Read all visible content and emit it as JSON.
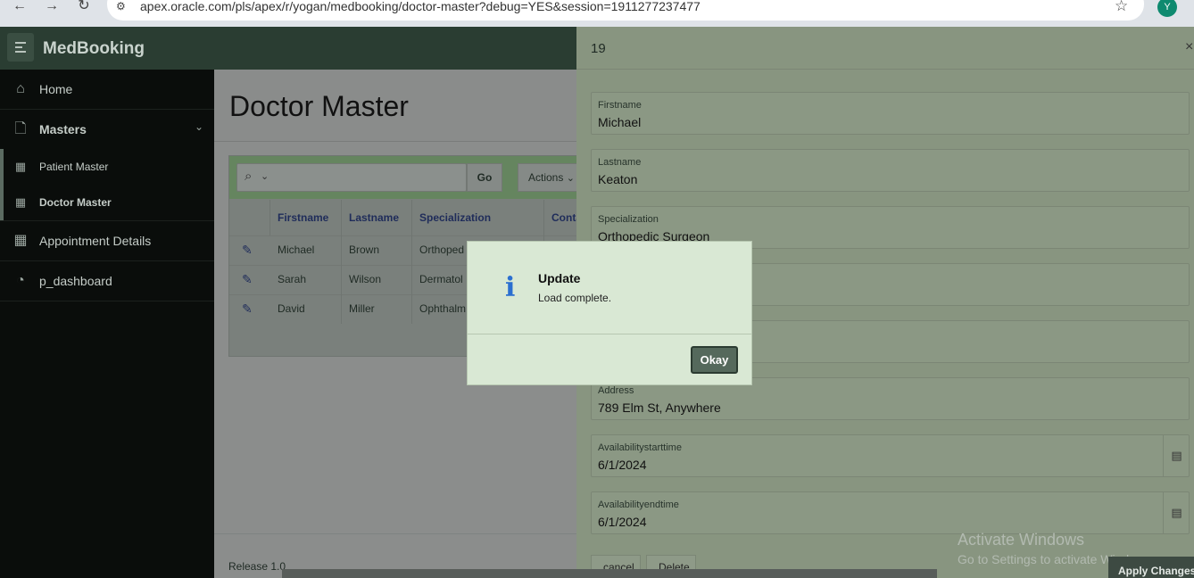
{
  "browser": {
    "url": "apex.oracle.com/pls/apex/r/yogan/medbooking/doctor-master?debug=YES&session=1911277237477",
    "back_icon": "←",
    "forward_icon": "→",
    "reload_icon": "↻",
    "star_icon": "☆",
    "profile_initial": "Y"
  },
  "app": {
    "title": "MedBooking"
  },
  "sidebar": {
    "home": "Home",
    "masters": "Masters",
    "patient_master": "Patient Master",
    "doctor_master": "Doctor Master",
    "appointment_details": "Appointment Details",
    "dashboard": "p_dashboard"
  },
  "page": {
    "title": "Doctor Master",
    "footer": "Release 1.0"
  },
  "toolbar": {
    "go_label": "Go",
    "actions_label": "Actions"
  },
  "report": {
    "columns": [
      "Firstname",
      "Lastname",
      "Specialization",
      "Conta"
    ],
    "rows": [
      [
        "Michael",
        "Brown",
        "Orthoped"
      ],
      [
        "Sarah",
        "Wilson",
        "Dermatol"
      ],
      [
        "David",
        "Miller",
        "Ophthalm"
      ]
    ]
  },
  "drawer": {
    "title": "19",
    "close_icon": "×",
    "fields": {
      "firstname": {
        "label": "Firstname",
        "value": "Michael"
      },
      "lastname": {
        "label": "Lastname",
        "value": "Keaton"
      },
      "specialization": {
        "label": "Specialization",
        "value": "Orthopedic Surgeon"
      },
      "address": {
        "label": "Address",
        "value": "789 Elm St, Anywhere"
      },
      "start": {
        "label": "Availabilitystarttime",
        "value": "6/1/2024"
      },
      "end": {
        "label": "Availabilityendtime",
        "value": "6/1/2024"
      }
    },
    "cancel_label": "cancel",
    "delete_label": "Delete"
  },
  "modal": {
    "icon": "i",
    "title": "Update",
    "message": "Load complete.",
    "okay_label": "Okay"
  },
  "watermark": {
    "line1": "Activate Windows",
    "line2": "Go to Settings to activate Windows."
  },
  "apply_changes": "Apply Changes"
}
